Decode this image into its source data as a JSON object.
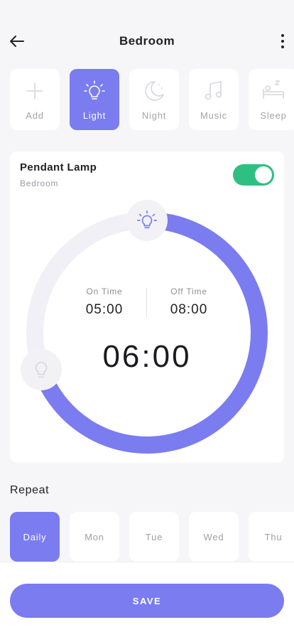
{
  "header": {
    "title": "Bedroom",
    "back_icon": "arrow-left-icon",
    "more_icon": "more-vertical-icon"
  },
  "modes": [
    {
      "label": "Add",
      "icon": "plus-icon",
      "active": false
    },
    {
      "label": "Light",
      "icon": "lightbulb-icon",
      "active": true
    },
    {
      "label": "Night",
      "icon": "moon-icon",
      "active": false
    },
    {
      "label": "Music",
      "icon": "music-note-icon",
      "active": false
    },
    {
      "label": "Sleep",
      "icon": "bed-icon",
      "active": false
    }
  ],
  "device": {
    "name": "Pendant Lamp",
    "room": "Bedroom",
    "power_on": true
  },
  "timer": {
    "on_label": "On Time",
    "on_value": "05:00",
    "off_label": "Off Time",
    "off_value": "08:00",
    "current": "06:00"
  },
  "repeat": {
    "title": "Repeat",
    "days": [
      {
        "label": "Daily",
        "active": true
      },
      {
        "label": "Mon",
        "active": false
      },
      {
        "label": "Tue",
        "active": false
      },
      {
        "label": "Wed",
        "active": false
      },
      {
        "label": "Thu",
        "active": false
      }
    ]
  },
  "footer": {
    "save_label": "SAVE"
  },
  "colors": {
    "accent": "#7a7cf0",
    "toggle_on": "#2fbf82",
    "track": "#f0f0f6"
  }
}
